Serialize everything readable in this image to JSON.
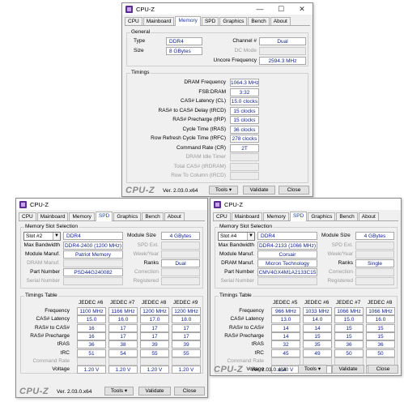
{
  "colors": {
    "accent": "#1a3fa8",
    "value_text": "#0d1f8f",
    "icon": "#5b2d8f"
  },
  "common": {
    "app_title": "CPU-Z",
    "brand": "CPU-Z",
    "version": "Ver. 2.03.0.x64",
    "tools": "Tools",
    "validate": "Validate",
    "close": "Close",
    "minimize": "—",
    "maximize": "☐",
    "win_close": "✕"
  },
  "tabs": [
    "CPU",
    "Mainboard",
    "Memory",
    "SPD",
    "Graphics",
    "Bench",
    "About"
  ],
  "mem": {
    "general_label": "General",
    "type_label": "Type",
    "type": "DDR4",
    "size_label": "Size",
    "size": "8 GBytes",
    "channel_label": "Channel #",
    "channel": "Dual",
    "dcmode_label": "DC Mode",
    "uncore_label": "Uncore Frequency",
    "uncore": "2594.3 MHz",
    "timings_label": "Timings",
    "rows": [
      {
        "label": "DRAM Frequency",
        "value": "1064.3 MHz"
      },
      {
        "label": "FSB:DRAM",
        "value": "3:32"
      },
      {
        "label": "CAS# Latency (CL)",
        "value": "15.0 clocks"
      },
      {
        "label": "RAS# to CAS# Delay (tRCD)",
        "value": "15 clocks"
      },
      {
        "label": "RAS# Precharge (tRP)",
        "value": "15 clocks"
      },
      {
        "label": "Cycle Time (tRAS)",
        "value": "36 clocks"
      },
      {
        "label": "Row Refresh Cycle Time (tRFC)",
        "value": "278 clocks"
      },
      {
        "label": "Command Rate (CR)",
        "value": "2T"
      },
      {
        "label": "DRAM Idle Timer",
        "value": ""
      },
      {
        "label": "Total CAS# (tRDRAM)",
        "value": ""
      },
      {
        "label": "Row To Column (tRCD)",
        "value": ""
      }
    ]
  },
  "spd_labels": {
    "slot_sel": "Memory Slot Selection",
    "max_bw": "Max Bandwidth",
    "module_manuf": "Module Manuf.",
    "dram_manuf": "DRAM Manuf.",
    "part": "Part Number",
    "serial": "Serial Number",
    "module_size": "Module Size",
    "spd_ext": "SPD Ext.",
    "week_year": "Week/Year",
    "ranks": "Ranks",
    "correction": "Correction",
    "registered": "Registered",
    "timings_table": "Timings Table",
    "row_labels": [
      "Frequency",
      "CAS# Latency",
      "RAS# to CAS#",
      "RAS# Precharge",
      "tRAS",
      "tRC",
      "Command Rate",
      "Voltage"
    ]
  },
  "spd1": {
    "slot": "Slot #2",
    "type": "DDR4",
    "module_size": "4 GBytes",
    "max_bw": "DDR4-2400 (1200 MHz)",
    "module_manuf": "Patriot Memory",
    "dram_manuf": "",
    "ranks": "Dual",
    "part": "PSD44G240082",
    "serial": "",
    "headers": [
      "JEDEC #6",
      "JEDEC #7",
      "JEDEC #8",
      "JEDEC #9"
    ],
    "rows": [
      [
        "1100 MHz",
        "1166 MHz",
        "1200 MHz",
        "1200 MHz"
      ],
      [
        "15.0",
        "16.0",
        "17.0",
        "18.0"
      ],
      [
        "16",
        "17",
        "17",
        "17"
      ],
      [
        "16",
        "17",
        "17",
        "17"
      ],
      [
        "36",
        "38",
        "39",
        "39"
      ],
      [
        "51",
        "54",
        "55",
        "55"
      ],
      [
        "",
        "",
        "",
        ""
      ],
      [
        "1.20 V",
        "1.20 V",
        "1.20 V",
        "1.20 V"
      ]
    ]
  },
  "spd2": {
    "slot": "Slot #4",
    "type": "DDR4",
    "module_size": "4 GBytes",
    "max_bw": "DDR4-2133 (1066 MHz)",
    "module_manuf": "Corsair",
    "dram_manuf": "Micron Technology",
    "ranks": "Single",
    "part": "CMV4GX4M1A2133C15",
    "serial": "",
    "headers": [
      "JEDEC #5",
      "JEDEC #6",
      "JEDEC #7",
      "JEDEC #8"
    ],
    "rows": [
      [
        "966 MHz",
        "1033 MHz",
        "1066 MHz",
        "1066 MHz"
      ],
      [
        "13.0",
        "14.0",
        "15.0",
        "16.0"
      ],
      [
        "14",
        "14",
        "15",
        "15"
      ],
      [
        "14",
        "15",
        "15",
        "15"
      ],
      [
        "32",
        "35",
        "36",
        "36"
      ],
      [
        "45",
        "49",
        "50",
        "50"
      ],
      [
        "",
        "",
        "",
        ""
      ],
      [
        "1.20 V",
        "1.20 V",
        "1.20 V",
        "1.20 V"
      ]
    ]
  }
}
